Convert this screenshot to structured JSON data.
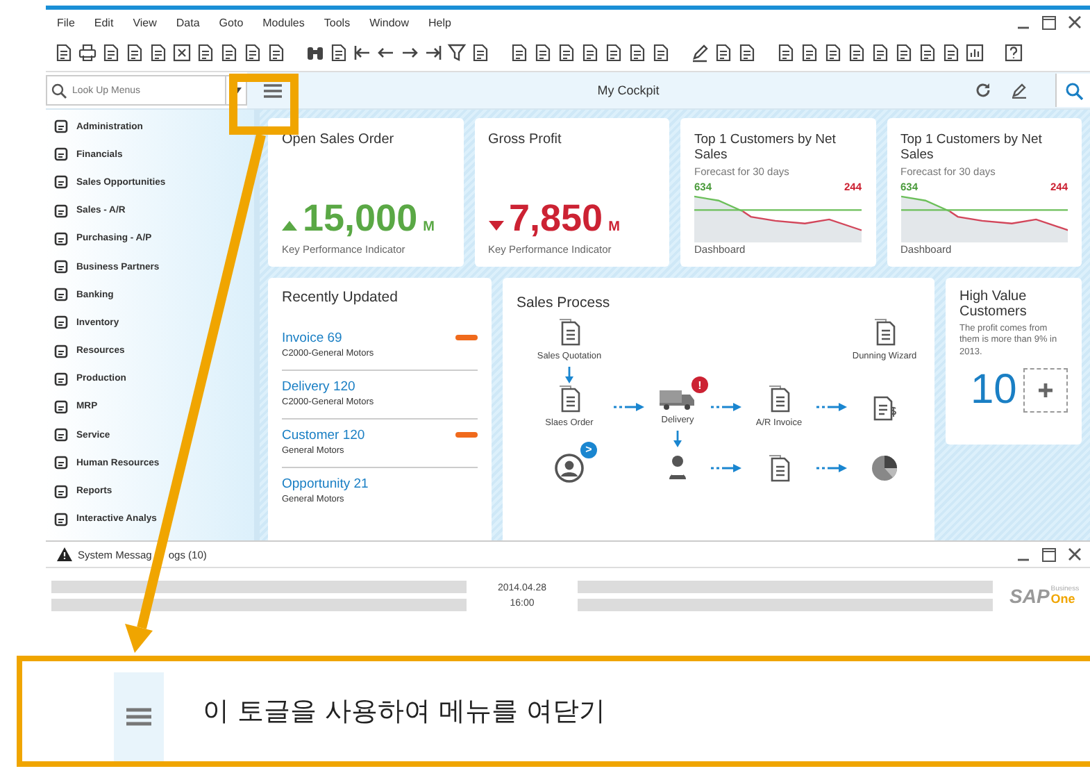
{
  "menu_bar": [
    "File",
    "Edit",
    "View",
    "Data",
    "Goto",
    "Modules",
    "Tools",
    "Window",
    "Help"
  ],
  "search": {
    "placeholder": "Look Up Menus"
  },
  "cockpit": {
    "title": "My Cockpit"
  },
  "sidebar": {
    "items": [
      {
        "label": "Administration"
      },
      {
        "label": "Financials"
      },
      {
        "label": "Sales Opportunities"
      },
      {
        "label": "Sales - A/R"
      },
      {
        "label": "Purchasing - A/P"
      },
      {
        "label": "Business Partners"
      },
      {
        "label": "Banking"
      },
      {
        "label": "Inventory"
      },
      {
        "label": "Resources"
      },
      {
        "label": "Production"
      },
      {
        "label": "MRP"
      },
      {
        "label": "Service"
      },
      {
        "label": "Human Resources"
      },
      {
        "label": "Reports"
      },
      {
        "label": "Interactive Analys"
      }
    ]
  },
  "kpi_cards": [
    {
      "title": "Open Sales Order",
      "kind": "up",
      "value": "15,000",
      "unit": "M",
      "caption": "Key Performance Indicator"
    },
    {
      "title": "Gross Profit",
      "kind": "down",
      "value": "7,850",
      "unit": "M",
      "caption": "Key Performance Indicator"
    }
  ],
  "forecast_cards": [
    {
      "title": "Top 1 Customers by Net Sales",
      "subtitle": "Forecast for 30 days",
      "start": "634",
      "end": "244",
      "footer": "Dashboard"
    },
    {
      "title": "Top 1 Customers by Net Sales",
      "subtitle": "Forecast for 30 days",
      "start": "634",
      "end": "244",
      "footer": "Dashboard"
    }
  ],
  "recently_updated": {
    "title": "Recently Updated",
    "items": [
      {
        "title": "Invoice 69",
        "subtitle": "C2000-General Motors",
        "flagged": true
      },
      {
        "title": "Delivery 120",
        "subtitle": "C2000-General Motors",
        "flagged": false
      },
      {
        "title": "Customer 120",
        "subtitle": "General Motors",
        "flagged": true
      },
      {
        "title": "Opportunity 21",
        "subtitle": "General Motors",
        "flagged": false
      }
    ]
  },
  "sales_process": {
    "title": "Sales Process",
    "nodes": [
      {
        "kind": "document",
        "label": "Sales Quotation"
      },
      {
        "kind": "document",
        "label": "Dunning Wizard"
      },
      {
        "kind": "document",
        "label": "Slaes Order"
      },
      {
        "kind": "truck",
        "label": "Delivery",
        "badge": "!"
      },
      {
        "kind": "document",
        "label": "A/R Invoice"
      },
      {
        "kind": "invoice"
      },
      {
        "kind": "contact",
        "badge": ">"
      },
      {
        "kind": "person"
      },
      {
        "kind": "document"
      },
      {
        "kind": "pie"
      }
    ]
  },
  "high_value": {
    "title": "High Value Customers",
    "description": "The profit comes from them is more than 9% in 2013.",
    "count": "10"
  },
  "messages": {
    "title_start": "System Messag",
    "title_end": "ogs (10)"
  },
  "status": {
    "date": "2014.04.28",
    "time": "16:00",
    "logo": {
      "brand": "SAP",
      "line1": "Business",
      "line2": "One"
    }
  },
  "callout": {
    "text": "이 토글을 사용하여 메뉴를 여닫기"
  }
}
